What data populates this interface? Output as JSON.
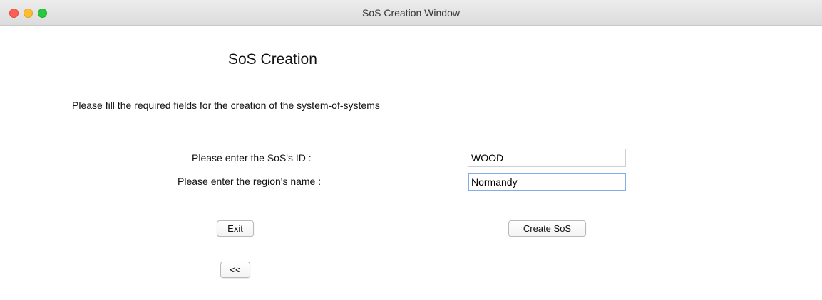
{
  "window": {
    "title": "SoS Creation Window"
  },
  "form": {
    "heading": "SoS Creation",
    "instructions": "Please fill the required fields for the creation of the system-of-systems",
    "id_label": "Please enter the SoS's ID :",
    "id_value": "WOOD",
    "region_label": "Please enter the region's name :",
    "region_value": "Normandy"
  },
  "buttons": {
    "exit": "Exit",
    "create": "Create SoS",
    "back": "<<"
  },
  "colors": {
    "close": "#fe5f57",
    "minimize": "#febc2e",
    "zoom": "#28c840",
    "focus_ring": "#80aee8"
  }
}
